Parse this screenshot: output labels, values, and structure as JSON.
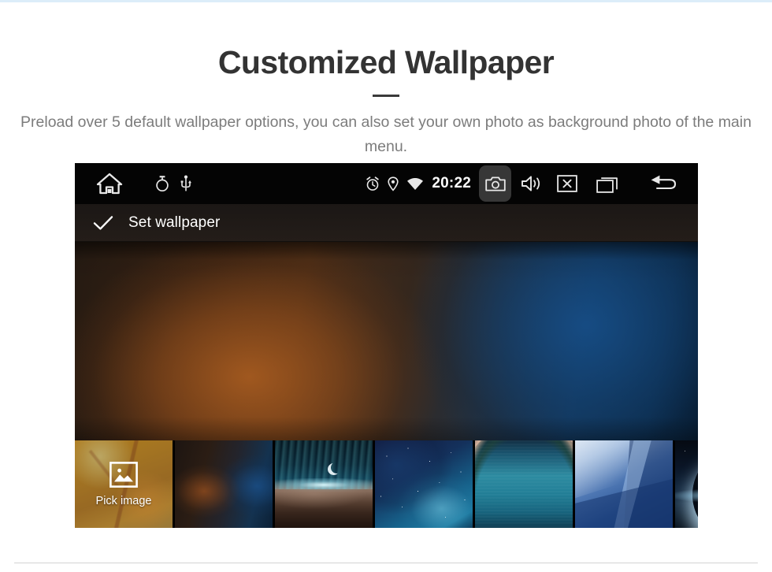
{
  "page": {
    "title": "Customized Wallpaper",
    "subtitle": "Preload over 5 default wallpaper options, you can also set your own photo as background photo of the main menu.",
    "accent_color": "#dcedf9",
    "title_color": "#333333",
    "subtitle_color": "#7c7c7c",
    "divider_color": "#d3d3d3"
  },
  "device": {
    "statusbar": {
      "background": "#040404",
      "clock": "20:22",
      "left_icons": [
        {
          "name": "home-icon",
          "label": "Home"
        },
        {
          "name": "timer-icon",
          "label": "Timer"
        },
        {
          "name": "usb-icon",
          "label": "USB"
        }
      ],
      "right_icons": [
        {
          "name": "alarm-icon",
          "label": "Alarm"
        },
        {
          "name": "location-icon",
          "label": "Location"
        },
        {
          "name": "wifi-icon",
          "label": "Wi-Fi"
        },
        {
          "name": "camera-icon",
          "label": "Screenshot",
          "highlighted": true,
          "highlight_color": "#373737"
        },
        {
          "name": "volume-icon",
          "label": "Volume"
        },
        {
          "name": "close-icon",
          "label": "Close"
        },
        {
          "name": "recent-apps-icon",
          "label": "Recent apps"
        },
        {
          "name": "back-icon",
          "label": "Back"
        }
      ]
    },
    "actionbar": {
      "check_icon": "check-icon",
      "label": "Set wallpaper",
      "text_color": "#ffffff"
    },
    "preview": {
      "description": "Blurred dark wallpaper preview with warm orange glow at left and deep blue glow at right"
    },
    "thumbnails": [
      {
        "name": "thumb-pick-image",
        "label": "Pick image",
        "icon": "picture-icon",
        "selected": false,
        "style": "pick"
      },
      {
        "name": "thumb-wallpaper-1",
        "label": "",
        "selected": true,
        "style": "current"
      },
      {
        "name": "thumb-wallpaper-2",
        "label": "",
        "selected": false,
        "style": "aurora"
      },
      {
        "name": "thumb-wallpaper-3",
        "label": "",
        "selected": false,
        "style": "nebula"
      },
      {
        "name": "thumb-wallpaper-4",
        "label": "",
        "selected": false,
        "style": "wave"
      },
      {
        "name": "thumb-wallpaper-5",
        "label": "",
        "selected": false,
        "style": "geo"
      },
      {
        "name": "thumb-wallpaper-6",
        "label": "",
        "selected": false,
        "style": "eclipse"
      }
    ]
  }
}
